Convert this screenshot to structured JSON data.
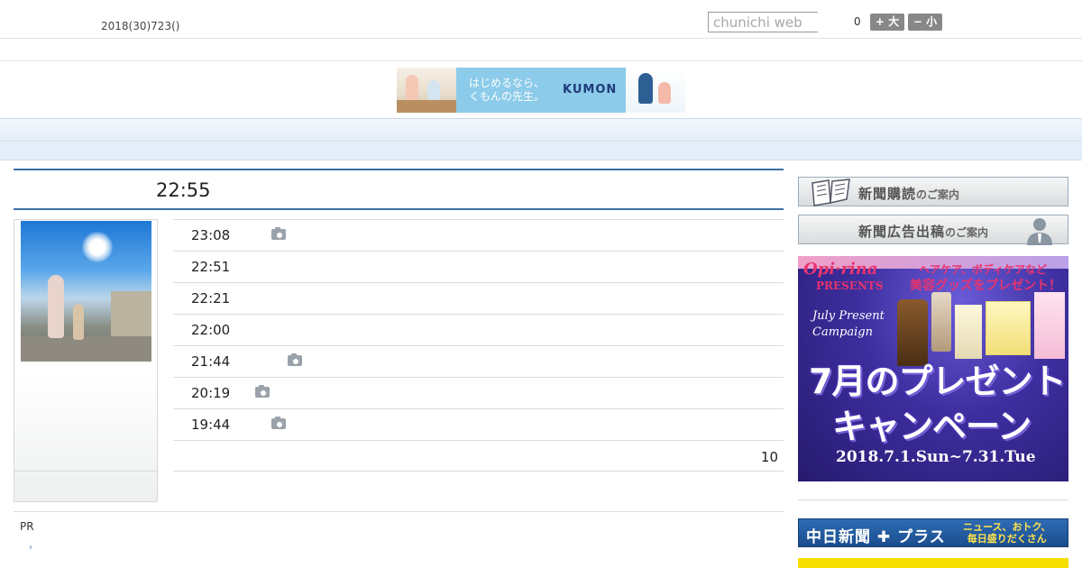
{
  "header": {
    "date": "2018(30)723()",
    "search_placeholder": "chunichi web",
    "fontsize_label": "0",
    "font_big": "+ 大",
    "font_small": "− 小"
  },
  "banner": {
    "text_line1": "はじめるなら、",
    "text_line2": "くもんの先生。",
    "logo": "KUMON"
  },
  "nav": {
    "items": [
      "",
      "",
      "",
      "",
      "",
      "",
      "",
      "",
      ""
    ]
  },
  "headline": {
    "time": "22:55"
  },
  "news_list": [
    {
      "time": "23:08",
      "has_photo": true
    },
    {
      "time": "22:51",
      "has_photo": false
    },
    {
      "time": "22:21",
      "has_photo": false
    },
    {
      "time": "22:00",
      "has_photo": false
    },
    {
      "time": "21:44",
      "has_photo": true
    },
    {
      "time": "20:19",
      "has_photo": true
    },
    {
      "time": "19:44",
      "has_photo": true
    }
  ],
  "more": {
    "count": "10"
  },
  "pr": {
    "label": "PR",
    "arrow": "›"
  },
  "sidebar": {
    "subscribe": {
      "main": "新聞購読",
      "suffix": "のご案内"
    },
    "ad_placement": {
      "main": "新聞広告出稿",
      "suffix": "のご案内"
    },
    "ad": {
      "brand": "Opi·rina",
      "presents": "PRESENTS",
      "care_line": "ヘアケア、ボディケアなど",
      "goods_line": "美容グッズをプレゼント！",
      "script_line1": "July Present",
      "script_line2": "Campaign",
      "headline1": "7月のプレゼント",
      "headline2": "キャンペーン",
      "dates": "2018.7.1.Sun~7.31.Tue"
    },
    "plus_banner": {
      "name": "中日新聞 ✚ プラス",
      "tag_line1": "ニュース、おトク、",
      "tag_line2": "毎日盛りだくさん"
    }
  },
  "colors": {
    "accent_blue": "#3c6fa8",
    "nav_bg": "#e4eef8",
    "ad_purple": "#3d2e9e",
    "camera_icon": "#9aa3ab"
  }
}
